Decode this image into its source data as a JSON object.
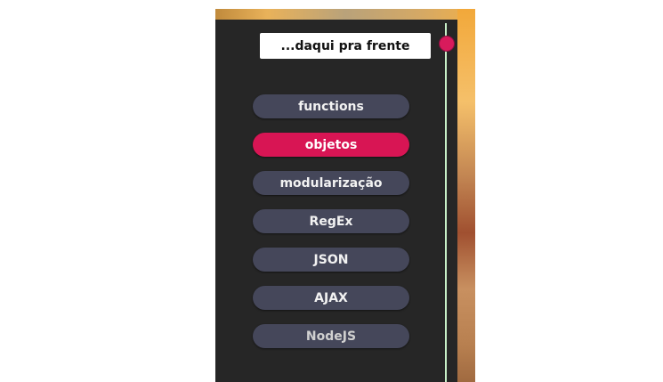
{
  "header": {
    "title": "...daqui pra frente"
  },
  "menu": {
    "items": [
      {
        "label": "functions",
        "active": false
      },
      {
        "label": "objetos",
        "active": true
      },
      {
        "label": "modularização",
        "active": false
      },
      {
        "label": "RegEx",
        "active": false
      },
      {
        "label": "JSON",
        "active": false
      },
      {
        "label": "AJAX",
        "active": false
      },
      {
        "label": "NodeJS",
        "active": false
      }
    ]
  },
  "colors": {
    "accent": "#d81554",
    "pill": "#45475a",
    "panel": "#262626"
  }
}
